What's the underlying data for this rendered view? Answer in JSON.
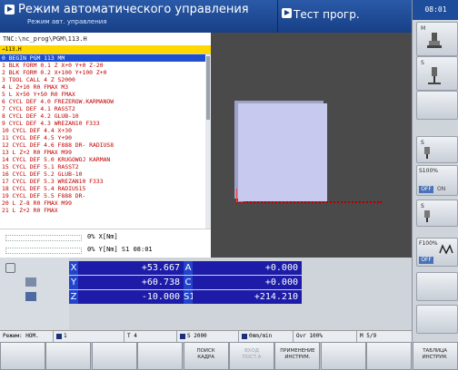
{
  "header": {
    "mode_title": "Режим автоматического управления",
    "mode_subtitle": "Режим авт. управления",
    "test_title": "Тест прогр."
  },
  "clock": "08:01",
  "program": {
    "path": "TNC:\\nc_prog\\PGM\\113.H",
    "tab": "→113.H",
    "lines": [
      "0  BEGIN PGM 113 MM",
      "1  BLK FORM 0.1 Z X+0 Y+0 Z-20",
      "2  BLK FORM 0.2  X+100  Y+100  Z+0",
      "3  TOOL CALL 4 Z S2000",
      "4  L  Z+10 R0 FMAX M3",
      "5  L  X+50 Y+50 R0 FMAX",
      "6  CYCL DEF 4.0 FREZEROW.KARMANOW",
      "7  CYCL DEF 4.1 RASST2",
      "8  CYCL DEF 4.2 GLUB-10",
      "9  CYCL DEF 4.3 WREZAN10 F333",
      "10 CYCL DEF 4.4 X+30",
      "11 CYCL DEF 4.5 Y+90",
      "12 CYCL DEF 4.6 F888 DR- RADIUS8",
      "13 L  Z+2 R0 FMAX M99",
      "14 CYCL DEF 5.0 KRUGOWOJ KARMAN",
      "15 CYCL DEF 5.1 RASST2",
      "16 CYCL DEF 5.2 GLUB-10",
      "17 CYCL DEF 5.3 WREZAN10 F333",
      "18 CYCL DEF 5.4 RADIUS15",
      "19 CYCL DEF 5.5 F888 DR-",
      "20 L  Z-8 R0 FMAX M99",
      "21 L  Z+2 R0 FMAX"
    ],
    "selected_index": 0
  },
  "status": {
    "row1": "0% X[Nm]",
    "row2": "0% Y[Nm] S1  08:01"
  },
  "positions": [
    {
      "axis": "X",
      "value": "+53.667",
      "axis2": "A",
      "value2": "+0.000"
    },
    {
      "axis": "Y",
      "value": "+60.738",
      "axis2": "C",
      "value2": "+0.000"
    },
    {
      "axis": "Z",
      "value": "-10.000",
      "axis2": "S1",
      "value2": "+214.210"
    }
  ],
  "strip": {
    "mode": "Режим: НОМ.",
    "t1": "1",
    "tool": "T 4",
    "spindle": "S 2000",
    "feed": "0mm/min",
    "ovr": "Ovr 100%",
    "m": "M 5/9"
  },
  "right_panel": {
    "m_label": "M",
    "s_label": "S",
    "s100": "S100%",
    "f100": "F100%",
    "off1": "OFF",
    "off2": "OFF",
    "on": "ON"
  },
  "softkeys": [
    {
      "label": "",
      "enabled": true
    },
    {
      "label": "",
      "enabled": true
    },
    {
      "label": "",
      "enabled": true
    },
    {
      "label": "",
      "enabled": true
    },
    {
      "label": "ПОИСК\nКАДРА",
      "enabled": true
    },
    {
      "label": "ВХОД\nПОСТ.А",
      "enabled": false
    },
    {
      "label": "ПРИМЕНЕНИЕ\nИНСТРУМ.",
      "enabled": true
    },
    {
      "label": "",
      "enabled": true
    },
    {
      "label": "",
      "enabled": true
    },
    {
      "label": "ТАБЛИЦА\nИНСТРУМ.",
      "enabled": true
    }
  ]
}
